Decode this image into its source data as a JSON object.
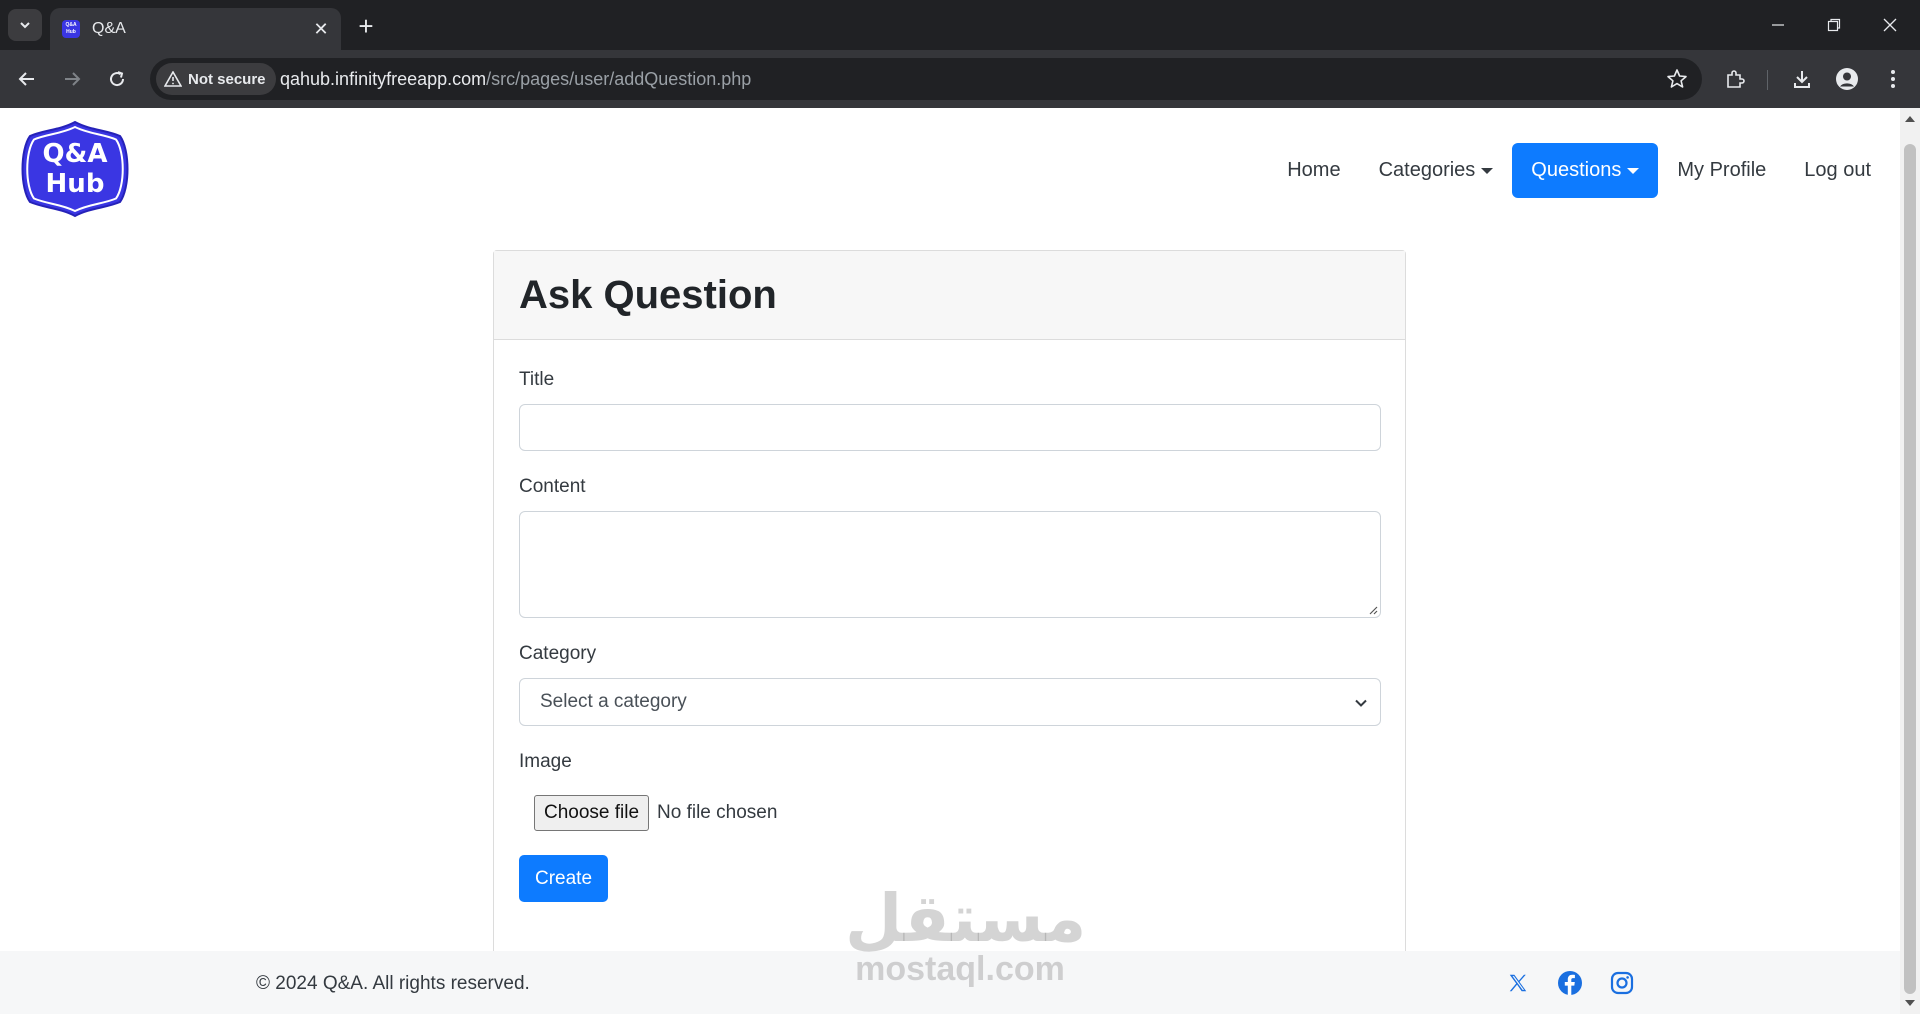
{
  "browser": {
    "tab_title": "Q&A",
    "favicon_text": "Q&A Hub",
    "security_label": "Not secure",
    "url_host": "qahub.infinityfreeapp.com",
    "url_path": "/src/pages/user/addQuestion.php"
  },
  "site": {
    "logo_line1": "Q&A",
    "logo_line2": "Hub",
    "brand_color": "#3a36e3",
    "accent_color": "#0d7bff"
  },
  "nav": {
    "home": "Home",
    "categories": "Categories",
    "questions": "Questions",
    "profile": "My Profile",
    "logout": "Log out"
  },
  "form": {
    "heading": "Ask Question",
    "title_label": "Title",
    "title_value": "",
    "content_label": "Content",
    "content_value": "",
    "category_label": "Category",
    "category_selected": "Select a category",
    "image_label": "Image",
    "file_button": "Choose file",
    "file_status": "No file chosen",
    "submit": "Create"
  },
  "watermark": {
    "arabic": "مستقل",
    "latin": "mostaql.com"
  },
  "footer": {
    "copyright": "© 2024 Q&A. All rights reserved.",
    "social_icons": [
      "x-icon",
      "facebook-icon",
      "instagram-icon"
    ]
  }
}
